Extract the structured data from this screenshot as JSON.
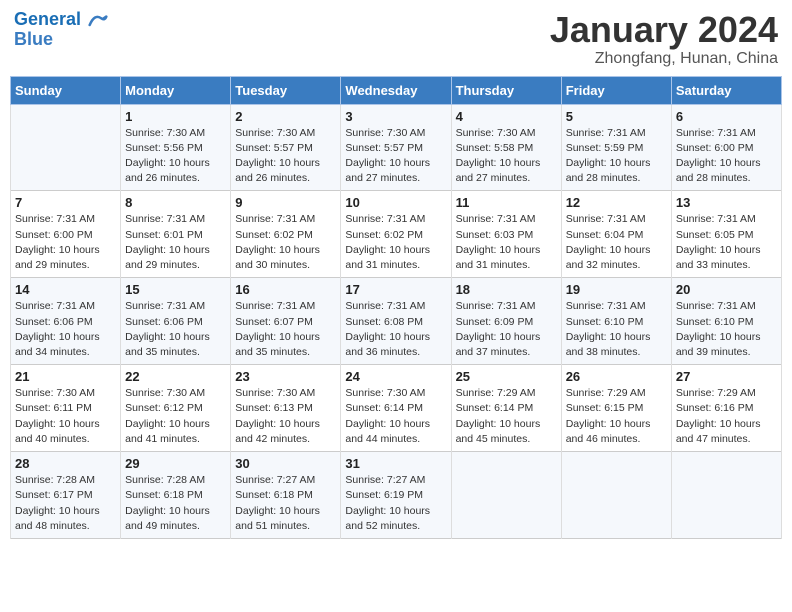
{
  "header": {
    "logo_line1": "General",
    "logo_line2": "Blue",
    "month": "January 2024",
    "location": "Zhongfang, Hunan, China"
  },
  "days_of_week": [
    "Sunday",
    "Monday",
    "Tuesday",
    "Wednesday",
    "Thursday",
    "Friday",
    "Saturday"
  ],
  "weeks": [
    [
      {
        "day": "",
        "info": ""
      },
      {
        "day": "1",
        "info": "Sunrise: 7:30 AM\nSunset: 5:56 PM\nDaylight: 10 hours\nand 26 minutes."
      },
      {
        "day": "2",
        "info": "Sunrise: 7:30 AM\nSunset: 5:57 PM\nDaylight: 10 hours\nand 26 minutes."
      },
      {
        "day": "3",
        "info": "Sunrise: 7:30 AM\nSunset: 5:57 PM\nDaylight: 10 hours\nand 27 minutes."
      },
      {
        "day": "4",
        "info": "Sunrise: 7:30 AM\nSunset: 5:58 PM\nDaylight: 10 hours\nand 27 minutes."
      },
      {
        "day": "5",
        "info": "Sunrise: 7:31 AM\nSunset: 5:59 PM\nDaylight: 10 hours\nand 28 minutes."
      },
      {
        "day": "6",
        "info": "Sunrise: 7:31 AM\nSunset: 6:00 PM\nDaylight: 10 hours\nand 28 minutes."
      }
    ],
    [
      {
        "day": "7",
        "info": "Sunrise: 7:31 AM\nSunset: 6:00 PM\nDaylight: 10 hours\nand 29 minutes."
      },
      {
        "day": "8",
        "info": "Sunrise: 7:31 AM\nSunset: 6:01 PM\nDaylight: 10 hours\nand 29 minutes."
      },
      {
        "day": "9",
        "info": "Sunrise: 7:31 AM\nSunset: 6:02 PM\nDaylight: 10 hours\nand 30 minutes."
      },
      {
        "day": "10",
        "info": "Sunrise: 7:31 AM\nSunset: 6:02 PM\nDaylight: 10 hours\nand 31 minutes."
      },
      {
        "day": "11",
        "info": "Sunrise: 7:31 AM\nSunset: 6:03 PM\nDaylight: 10 hours\nand 31 minutes."
      },
      {
        "day": "12",
        "info": "Sunrise: 7:31 AM\nSunset: 6:04 PM\nDaylight: 10 hours\nand 32 minutes."
      },
      {
        "day": "13",
        "info": "Sunrise: 7:31 AM\nSunset: 6:05 PM\nDaylight: 10 hours\nand 33 minutes."
      }
    ],
    [
      {
        "day": "14",
        "info": "Sunrise: 7:31 AM\nSunset: 6:06 PM\nDaylight: 10 hours\nand 34 minutes."
      },
      {
        "day": "15",
        "info": "Sunrise: 7:31 AM\nSunset: 6:06 PM\nDaylight: 10 hours\nand 35 minutes."
      },
      {
        "day": "16",
        "info": "Sunrise: 7:31 AM\nSunset: 6:07 PM\nDaylight: 10 hours\nand 35 minutes."
      },
      {
        "day": "17",
        "info": "Sunrise: 7:31 AM\nSunset: 6:08 PM\nDaylight: 10 hours\nand 36 minutes."
      },
      {
        "day": "18",
        "info": "Sunrise: 7:31 AM\nSunset: 6:09 PM\nDaylight: 10 hours\nand 37 minutes."
      },
      {
        "day": "19",
        "info": "Sunrise: 7:31 AM\nSunset: 6:10 PM\nDaylight: 10 hours\nand 38 minutes."
      },
      {
        "day": "20",
        "info": "Sunrise: 7:31 AM\nSunset: 6:10 PM\nDaylight: 10 hours\nand 39 minutes."
      }
    ],
    [
      {
        "day": "21",
        "info": "Sunrise: 7:30 AM\nSunset: 6:11 PM\nDaylight: 10 hours\nand 40 minutes."
      },
      {
        "day": "22",
        "info": "Sunrise: 7:30 AM\nSunset: 6:12 PM\nDaylight: 10 hours\nand 41 minutes."
      },
      {
        "day": "23",
        "info": "Sunrise: 7:30 AM\nSunset: 6:13 PM\nDaylight: 10 hours\nand 42 minutes."
      },
      {
        "day": "24",
        "info": "Sunrise: 7:30 AM\nSunset: 6:14 PM\nDaylight: 10 hours\nand 44 minutes."
      },
      {
        "day": "25",
        "info": "Sunrise: 7:29 AM\nSunset: 6:14 PM\nDaylight: 10 hours\nand 45 minutes."
      },
      {
        "day": "26",
        "info": "Sunrise: 7:29 AM\nSunset: 6:15 PM\nDaylight: 10 hours\nand 46 minutes."
      },
      {
        "day": "27",
        "info": "Sunrise: 7:29 AM\nSunset: 6:16 PM\nDaylight: 10 hours\nand 47 minutes."
      }
    ],
    [
      {
        "day": "28",
        "info": "Sunrise: 7:28 AM\nSunset: 6:17 PM\nDaylight: 10 hours\nand 48 minutes."
      },
      {
        "day": "29",
        "info": "Sunrise: 7:28 AM\nSunset: 6:18 PM\nDaylight: 10 hours\nand 49 minutes."
      },
      {
        "day": "30",
        "info": "Sunrise: 7:27 AM\nSunset: 6:18 PM\nDaylight: 10 hours\nand 51 minutes."
      },
      {
        "day": "31",
        "info": "Sunrise: 7:27 AM\nSunset: 6:19 PM\nDaylight: 10 hours\nand 52 minutes."
      },
      {
        "day": "",
        "info": ""
      },
      {
        "day": "",
        "info": ""
      },
      {
        "day": "",
        "info": ""
      }
    ]
  ]
}
